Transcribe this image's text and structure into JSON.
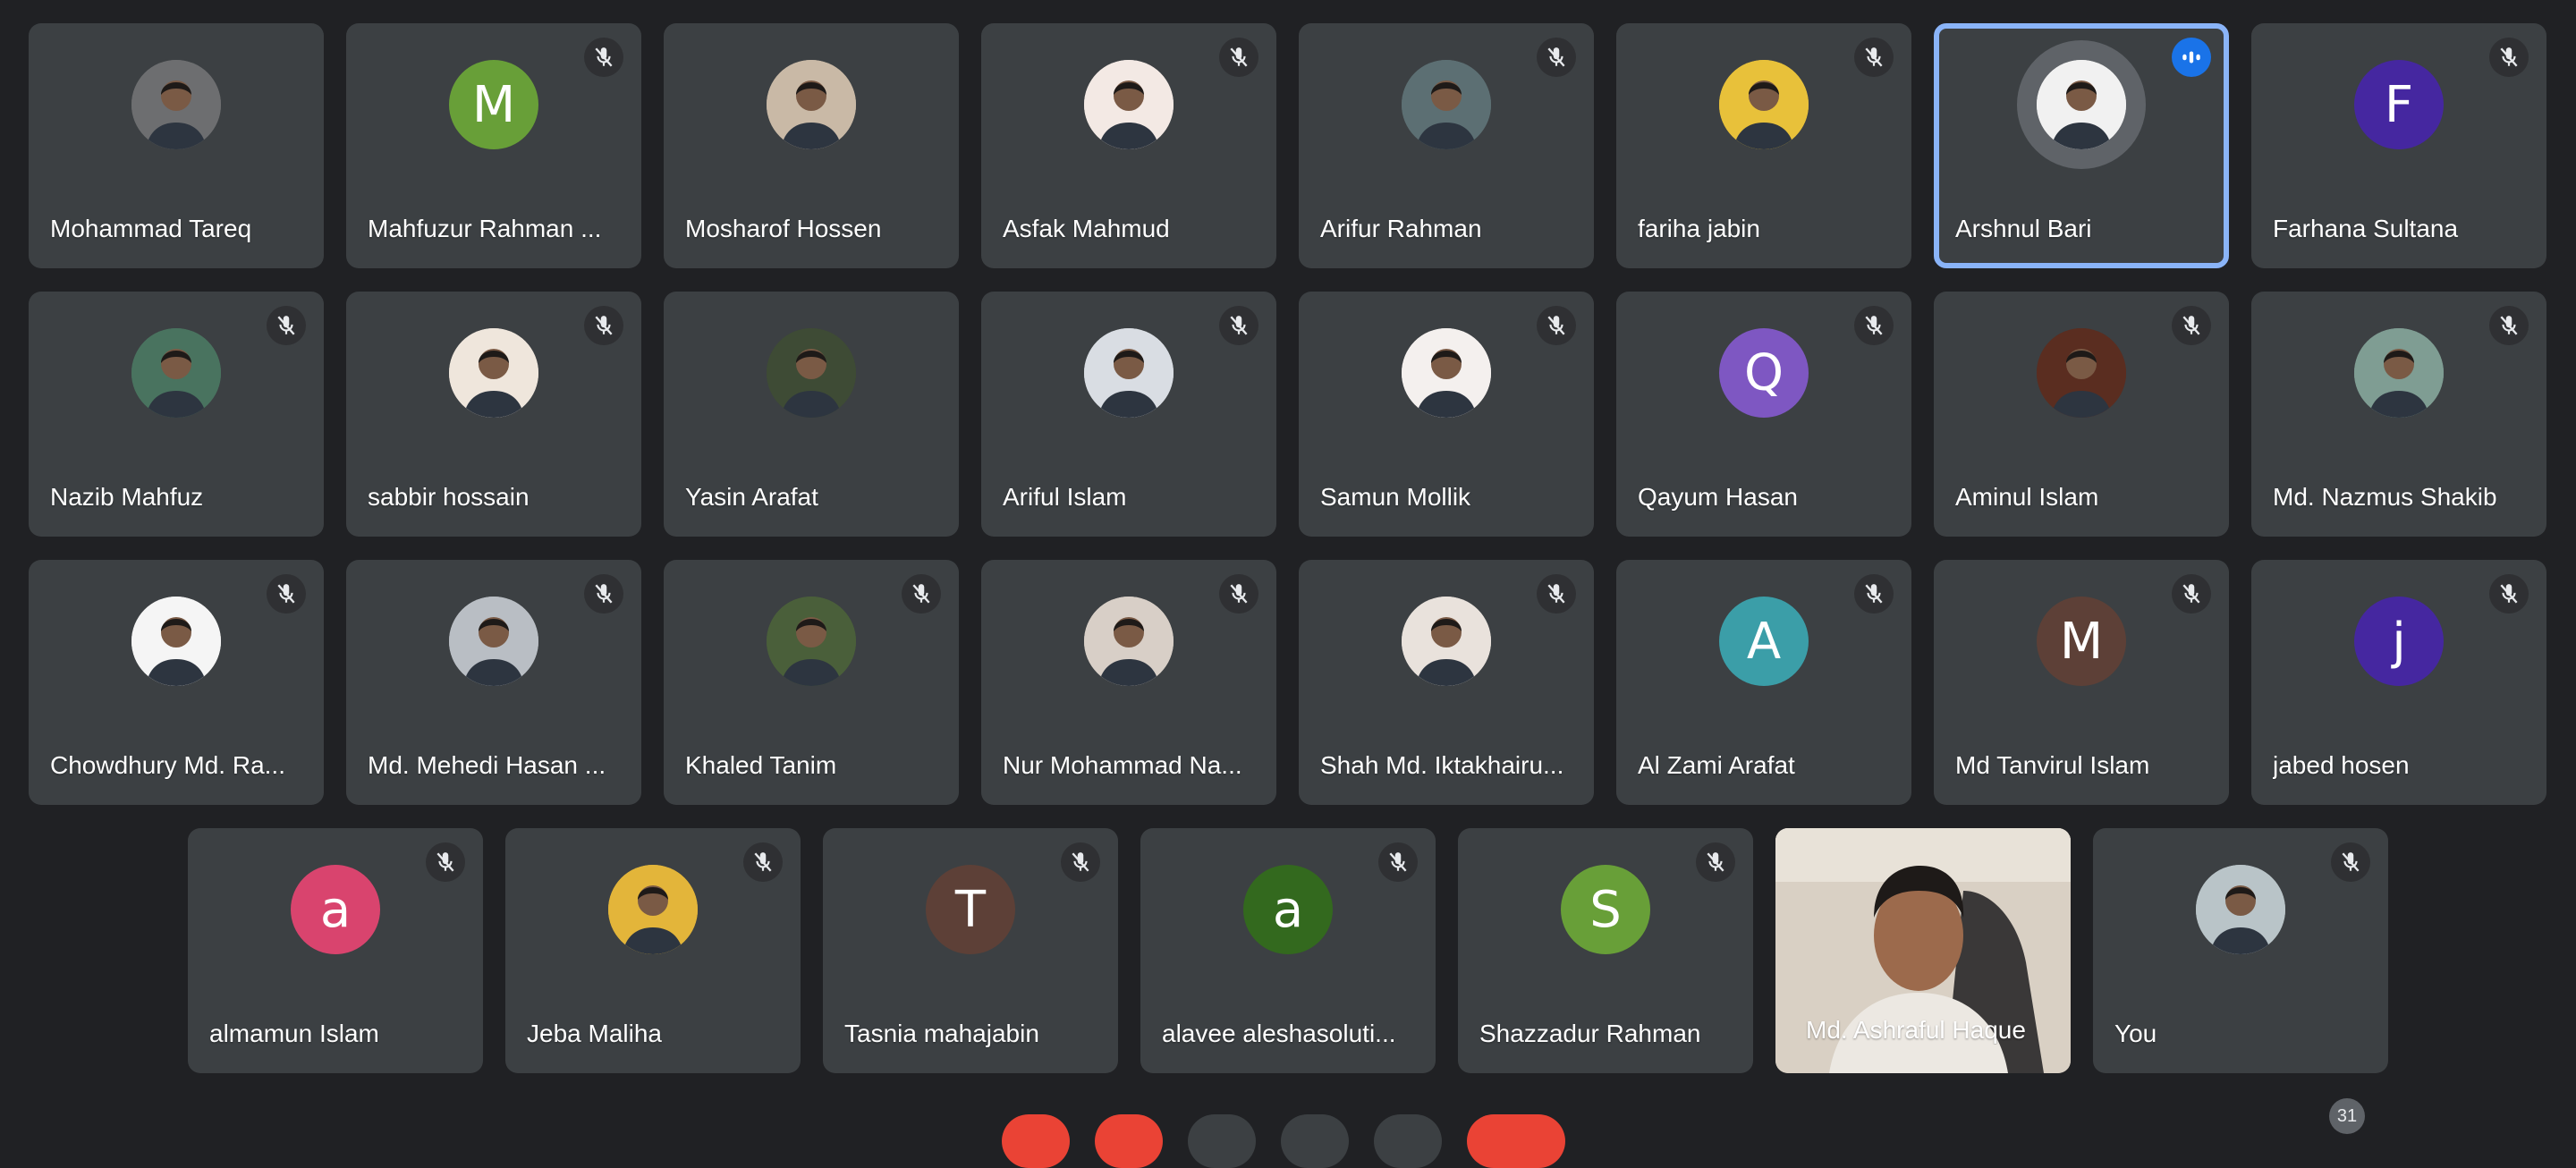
{
  "participants": [
    {
      "name": "Mohammad Tareq",
      "muted": false,
      "avatar_type": "photo",
      "photo": "mohammad-tareq-photo",
      "avatar_color": "#6d6e70"
    },
    {
      "name": "Mahfuzur Rahman ...",
      "muted": true,
      "avatar_type": "letter",
      "letter": "M",
      "avatar_color": "#689f38"
    },
    {
      "name": "Mosharof Hossen",
      "muted": false,
      "avatar_type": "photo",
      "photo": "mosharof-hossen-photo",
      "avatar_color": "#c9b9a6"
    },
    {
      "name": "Asfak Mahmud",
      "muted": true,
      "avatar_type": "photo",
      "photo": "asfak-mahmud-photo",
      "avatar_color": "#f3e9e4"
    },
    {
      "name": "Arifur Rahman",
      "muted": true,
      "avatar_type": "photo",
      "photo": "arifur-rahman-photo",
      "avatar_color": "#5c6f73"
    },
    {
      "name": "fariha jabin",
      "muted": true,
      "avatar_type": "photo",
      "photo": "fariha-jabin-photo",
      "avatar_color": "#e8c13a"
    },
    {
      "name": "Arshnul Bari",
      "muted": false,
      "speaking": true,
      "avatar_type": "photo",
      "photo": "arshnul-bari-photo",
      "avatar_color": "#f1f1f1"
    },
    {
      "name": "Farhana Sultana",
      "muted": true,
      "avatar_type": "letter",
      "letter": "F",
      "avatar_color": "#4527a0"
    },
    {
      "name": "Nazib Mahfuz",
      "muted": true,
      "avatar_type": "photo",
      "photo": "nazib-mahfuz-photo",
      "avatar_color": "#49735f"
    },
    {
      "name": "sabbir hossain",
      "muted": true,
      "avatar_type": "photo",
      "photo": "sabbir-hossain-photo",
      "avatar_color": "#efe6dc"
    },
    {
      "name": "Yasin Arafat",
      "muted": false,
      "avatar_type": "photo",
      "photo": "yasin-arafat-photo",
      "avatar_color": "#3e4b35"
    },
    {
      "name": "Ariful Islam",
      "muted": true,
      "avatar_type": "photo",
      "photo": "ariful-islam-photo",
      "avatar_color": "#d9dde3"
    },
    {
      "name": "Samun Mollik",
      "muted": true,
      "avatar_type": "photo",
      "photo": "samun-mollik-photo",
      "avatar_color": "#f4f0ee"
    },
    {
      "name": "Qayum Hasan",
      "muted": true,
      "avatar_type": "letter",
      "letter": "Q",
      "avatar_color": "#7e57c2"
    },
    {
      "name": "Aminul Islam",
      "muted": true,
      "avatar_type": "photo",
      "photo": "aminul-islam-photo",
      "avatar_color": "#5a2d20"
    },
    {
      "name": "Md. Nazmus Shakib",
      "muted": true,
      "avatar_type": "photo",
      "photo": "nazmus-shakib-photo",
      "avatar_color": "#7f9d93"
    },
    {
      "name": "Chowdhury Md. Ra...",
      "muted": true,
      "avatar_type": "photo",
      "photo": "chowdhury-photo",
      "avatar_color": "#f5f5f5"
    },
    {
      "name": "Md. Mehedi Hasan ...",
      "muted": true,
      "avatar_type": "photo",
      "photo": "mehedi-hasan-photo",
      "avatar_color": "#b9bec4"
    },
    {
      "name": "Khaled Tanim",
      "muted": true,
      "avatar_type": "photo",
      "photo": "khaled-tanim-photo",
      "avatar_color": "#4a5f3a"
    },
    {
      "name": "Nur Mohammad Na...",
      "muted": true,
      "avatar_type": "photo",
      "photo": "nur-mohammad-photo",
      "avatar_color": "#d8cfc7"
    },
    {
      "name": "Shah Md. Iktakhairu...",
      "muted": true,
      "avatar_type": "photo",
      "photo": "shah-md-photo",
      "avatar_color": "#e9e2dc"
    },
    {
      "name": "Al Zami Arafat",
      "muted": true,
      "avatar_type": "letter",
      "letter": "A",
      "avatar_color": "#3b9ea8"
    },
    {
      "name": "Md Tanvirul Islam",
      "muted": true,
      "avatar_type": "letter",
      "letter": "M",
      "avatar_color": "#5d4037"
    },
    {
      "name": "jabed hosen",
      "muted": true,
      "avatar_type": "letter",
      "letter": "j",
      "avatar_color": "#4527a0"
    },
    {
      "name": "almamun Islam",
      "muted": true,
      "avatar_type": "letter",
      "letter": "a",
      "avatar_color": "#d9446e"
    },
    {
      "name": "Jeba Maliha",
      "muted": true,
      "avatar_type": "photo",
      "photo": "jeba-maliha-photo",
      "avatar_color": "#e3b53a"
    },
    {
      "name": "Tasnia mahajabin",
      "muted": true,
      "avatar_type": "letter",
      "letter": "T",
      "avatar_color": "#5d4037"
    },
    {
      "name": "alavee aleshasoluti...",
      "muted": true,
      "avatar_type": "letter",
      "letter": "a",
      "avatar_color": "#33691e"
    },
    {
      "name": "Shazzadur Rahman",
      "muted": true,
      "avatar_type": "letter",
      "letter": "S",
      "avatar_color": "#689f38"
    },
    {
      "name": "Md. Ashraful Haque",
      "muted": false,
      "avatar_type": "video",
      "avatar_color": "#cfc4b6"
    },
    {
      "name": "You",
      "muted": true,
      "avatar_type": "photo",
      "photo": "you-photo",
      "avatar_color": "#b9c4c8"
    }
  ],
  "colors": {
    "background": "#202124",
    "tile": "#3c4043",
    "speaking_border": "#8ab4f8",
    "speaking_indicator": "#1a73e8",
    "end_call": "#ea4335"
  },
  "bottom_bar": {
    "participant_count": "31"
  }
}
